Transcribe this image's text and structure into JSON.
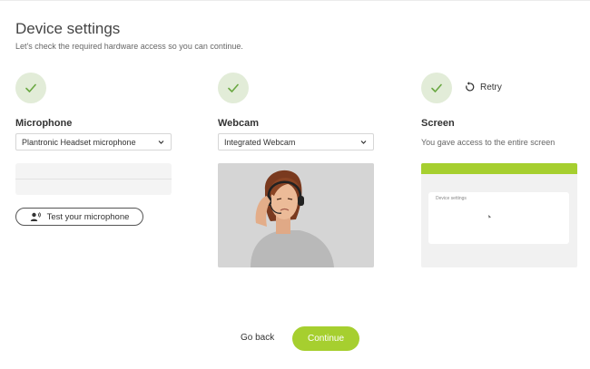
{
  "page": {
    "title": "Device settings",
    "subtitle": "Let's check the required hardware access so you can continue."
  },
  "colors": {
    "accent": "#a6cf2f",
    "check_bg": "#e2ecd8",
    "check_mark": "#6aa842"
  },
  "microphone": {
    "title": "Microphone",
    "status_icon": "check-icon",
    "selected_device": "Plantronic Headset microphone",
    "test_button_label": "Test your microphone",
    "test_button_icon": "speaking-person-icon"
  },
  "webcam": {
    "title": "Webcam",
    "status_icon": "check-icon",
    "selected_device": "Integrated Webcam",
    "preview_icon": "person-with-headset"
  },
  "screen": {
    "title": "Screen",
    "status_icon": "check-icon",
    "retry_label": "Retry",
    "retry_icon": "rotate-icon",
    "status_text": "You gave access to the entire screen",
    "preview_card_title": "Device settings"
  },
  "footer": {
    "back_label": "Go back",
    "continue_label": "Continue"
  }
}
